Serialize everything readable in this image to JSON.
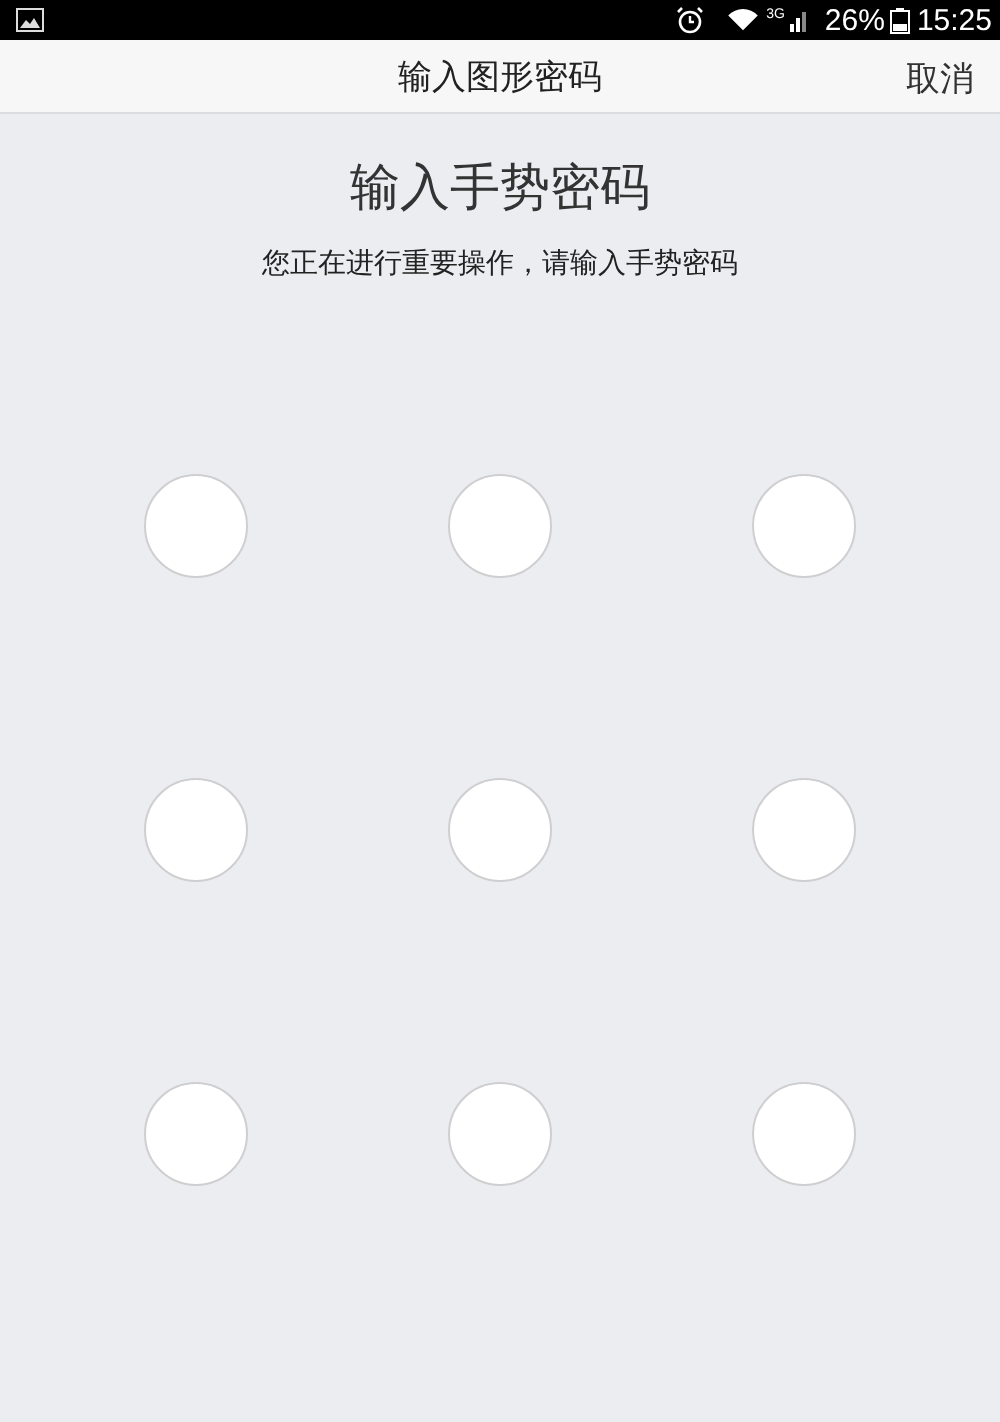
{
  "status_bar": {
    "network": "3G",
    "battery": "26%",
    "time": "15:25"
  },
  "header": {
    "title": "输入图形密码",
    "cancel": "取消"
  },
  "heading": "输入手势密码",
  "subtitle": "您正在进行重要操作，请输入手势密码",
  "pattern_dots": [
    {
      "selected": false
    },
    {
      "selected": false
    },
    {
      "selected": false
    },
    {
      "selected": false
    },
    {
      "selected": false
    },
    {
      "selected": false
    },
    {
      "selected": false
    },
    {
      "selected": false
    },
    {
      "selected": false
    }
  ]
}
